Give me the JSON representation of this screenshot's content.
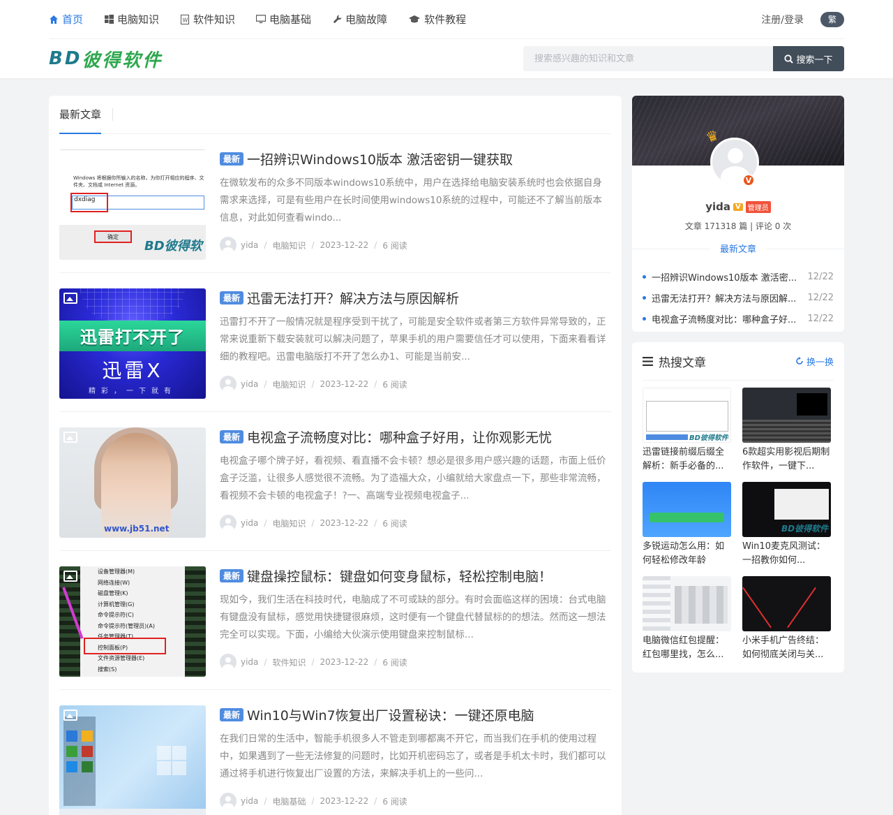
{
  "nav": {
    "items": [
      {
        "label": "首页",
        "icon": "home-icon",
        "active": true
      },
      {
        "label": "电脑知识",
        "icon": "windows-icon",
        "active": false
      },
      {
        "label": "软件知识",
        "icon": "document-icon",
        "active": false
      },
      {
        "label": "电脑基础",
        "icon": "monitor-icon",
        "active": false
      },
      {
        "label": "电脑故障",
        "icon": "wrench-icon",
        "active": false
      },
      {
        "label": "软件教程",
        "icon": "graduation-cap-icon",
        "active": false
      }
    ],
    "login": "注册/登录",
    "lang_toggle": "繁"
  },
  "brand": {
    "logo_part1": "BD",
    "logo_part2": "彼得软件"
  },
  "search": {
    "placeholder": "搜索感兴趣的知识和文章",
    "button": "搜索一下"
  },
  "content": {
    "tab_label": "最新文章",
    "posts": [
      {
        "badge": "最新",
        "title": "一招辨识Windows10版本 激活密钥一键获取",
        "excerpt": "在微软发布的众多不同版本windows10系统中，用户在选择给电脑安装系统时也会依据自身需求来选择，可是有些用户在长时间使用windows10系统的过程中，可能还不了解当前版本信息，对此如何查看windo...",
        "author": "yida",
        "category": "电脑知识",
        "date": "2023-12-22",
        "views": "6 阅读",
        "thumb_text_a": "Windows 将根据你所输入的名称，为你打开相应的程序、文件夹、文档或 Internet 资源。",
        "thumb_text_b": "dxdiag",
        "thumb_text_c": "确定",
        "thumb_watermark": "BD彼得软"
      },
      {
        "badge": "最新",
        "title": "迅雷无法打开？解决方法与原因解析",
        "excerpt": "迅雷打不开了一般情况就是程序受到干扰了，可能是安全软件或者第三方软件异常导致的，正常来说重新下载安装就可以解决问题了，苹果手机的用户需要信任才可以使用，下面来看看详细的教程吧。迅雷电脑版打不开了怎么办1、可能是当前安...",
        "author": "yida",
        "category": "电脑知识",
        "date": "2023-12-22",
        "views": "6 阅读",
        "thumb_text_a": "迅雷打不开了",
        "thumb_text_b": "迅雷X",
        "thumb_text_c": "精彩，一下就有"
      },
      {
        "badge": "最新",
        "title": "电视盒子流畅度对比：哪种盒子好用，让你观影无忧",
        "excerpt": "电视盒子哪个牌子好，看视频、看直播不会卡顿？想必是很多用户感兴趣的话题，市面上低价盒子泛滥，让很多人感觉很不流畅。为了造福大众，小编就给大家盘点一下，那些非常流畅，看视频不会卡顿的电视盒子！?一、高端专业视频电视盒子...",
        "author": "yida",
        "category": "电脑知识",
        "date": "2023-12-22",
        "views": "6 阅读",
        "thumb_watermark": "www.jb51.net"
      },
      {
        "badge": "最新",
        "title": "键盘操控鼠标：键盘如何变身鼠标，轻松控制电脑！",
        "excerpt": "现如今，我们生活在科技时代，电脑成了不可或缺的部分。有时会面临这样的困境：台式电脑有键盘没有鼠标，感觉用快捷键很麻烦，这时便有一个键盘代替鼠标的的想法。然而这一想法完全可以实现。下面，小编给大伙演示使用键盘来控制鼠标...",
        "author": "yida",
        "category": "软件知识",
        "date": "2023-12-22",
        "views": "6 阅读",
        "thumb_menu": [
          "设备管理器(M)",
          "网络连接(W)",
          "磁盘管理(K)",
          "计算机管理(G)",
          "命令提示符(C)",
          "命令提示符(管理员)(A)",
          "任务管理器(T)",
          "控制面板(P)",
          "文件资源管理器(E)",
          "搜索(S)"
        ]
      },
      {
        "badge": "最新",
        "title": "Win10与Win7恢复出厂设置秘诀：一键还原电脑",
        "excerpt": "在我们日常的生活中，智能手机很多人不管走到哪都离不开它，而当我们在手机的使用过程中，如果遇到了一些无法修复的问题时，比如开机密码忘了，或者是手机太卡时，我们都可以通过将手机进行恢复出厂设置的方法，来解决手机上的一些问...",
        "author": "yida",
        "category": "电脑基础",
        "date": "2023-12-22",
        "views": "6 阅读"
      }
    ]
  },
  "author_card": {
    "name": "yida",
    "v_badge": "V",
    "role": "管理员",
    "stats": "文章 171318 篇 | 评论 0 次",
    "latest_title": "最新文章",
    "latest": [
      {
        "title": "一招辨识Windows10版本 激活密...",
        "date": "12/22"
      },
      {
        "title": "迅雷无法打开？解决方法与原因解...",
        "date": "12/22"
      },
      {
        "title": "电视盒子流畅度对比：哪种盒子好...",
        "date": "12/22"
      }
    ]
  },
  "hot": {
    "title": "热搜文章",
    "refresh": "换一换",
    "items": [
      {
        "text": "迅雷链接前缀后缀全解析：新手必备的..."
      },
      {
        "text": "6款超实用影视后期制作软件，一键下..."
      },
      {
        "text": "多锐运动怎么用：如何轻松修改年龄"
      },
      {
        "text": "Win10麦克风测试：一招教你如何..."
      },
      {
        "text": "电脑微信红包提醒：红包哪里找，怎么..."
      },
      {
        "text": "小米手机广告终结：如何彻底关闭与关..."
      }
    ],
    "thumb_wm_1": "BD彼得软件",
    "thumb_wm_4": "BD彼得软件"
  },
  "colors": {
    "accent": "#2a7ae2",
    "badge_new": "#4f8ce0",
    "search_button": "#424d5a",
    "logo_teal": "#1f7a8c",
    "logo_green": "#2fa84f"
  }
}
